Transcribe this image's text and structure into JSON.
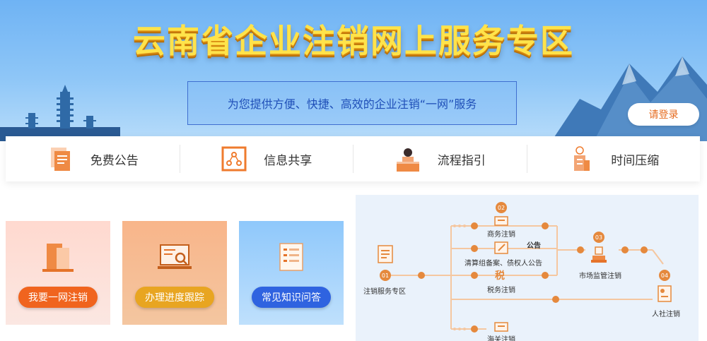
{
  "banner": {
    "title": "云南省企业注销网上服务专区",
    "subtitle": "为您提供方便、快捷、高效的企业注销“一网”服务",
    "login_label": "请登录"
  },
  "nav": [
    {
      "label": "免费公告"
    },
    {
      "label": "信息共享"
    },
    {
      "label": "流程指引"
    },
    {
      "label": "时间压缩"
    }
  ],
  "cards": [
    {
      "label": "我要一网注销",
      "bg_from": "#ffd9cf",
      "bg_to": "#fbe7e2",
      "btn_color": "#f0641e"
    },
    {
      "label": "办理进度跟踪",
      "bg_from": "#f8b58a",
      "bg_to": "#f4c6a0",
      "btn_color": "#e8a521"
    },
    {
      "label": "常见知识问答",
      "bg_from": "#8fc8fb",
      "bg_to": "#bfe0fc",
      "btn_color": "#2f63e0"
    }
  ],
  "flow": {
    "start_num": "01",
    "start_label": "注销服务专区",
    "n02": "02",
    "commerce_label": "商务注销",
    "clearing_label": "清算组备案、债权人公告",
    "announce_label": "公告",
    "tax_label": "税务注销",
    "tax_icon": "税",
    "n03": "03",
    "market_label": "市场监管注销",
    "n04": "04",
    "social_label": "人社注销",
    "customs_label": "海关注销",
    "accent": "#e5893d",
    "line_color": "#f5c7a0"
  }
}
